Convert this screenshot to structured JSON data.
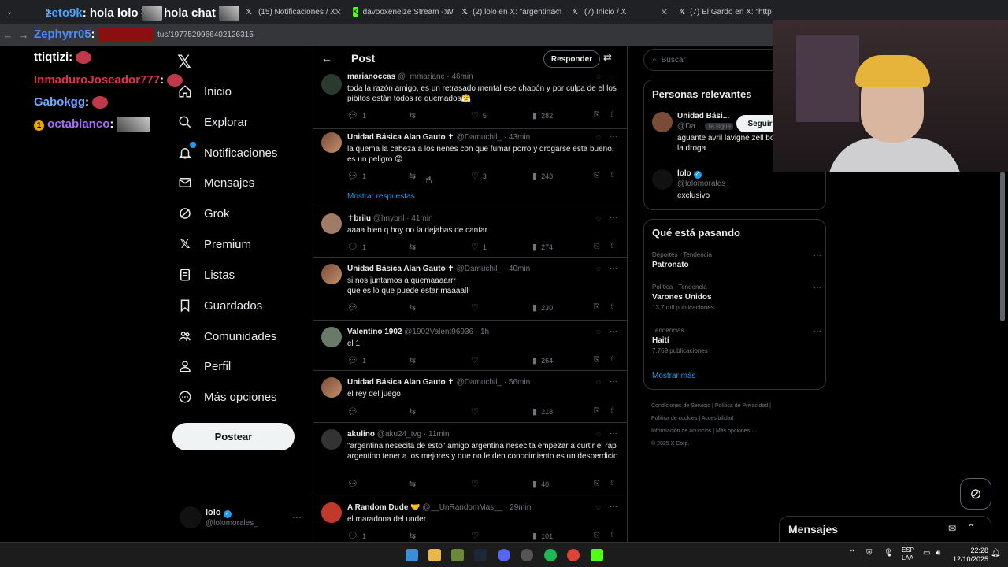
{
  "browser": {
    "tabs": [
      {
        "label": "",
        "icon": "x-logo-icon"
      },
      {
        "label": "",
        "icon": "x-logo-icon"
      },
      {
        "label": "(15) Notificaciones / X",
        "icon": "x-logo-icon"
      },
      {
        "label": "davooxeneize Stream - W",
        "icon": "kick-icon"
      },
      {
        "label": "(2) lolo en X: \"argentina n",
        "icon": "x-logo-icon"
      },
      {
        "label": "(7) Inicio / X",
        "icon": "x-logo-icon"
      },
      {
        "label": "(7) El Gardo en X: \"https",
        "icon": "x-logo-icon"
      }
    ],
    "url": "tus/1977529966402126315"
  },
  "chat": [
    {
      "user": "zeto9k",
      "message": "hola lolo",
      "color": "#4aa3ff"
    },
    {
      "user": "",
      "message": "hola chat",
      "color": "#ffffff"
    },
    {
      "user": "Zephyrr05",
      "message": "",
      "color": "#4a8cff"
    },
    {
      "user": "ttiqtizi",
      "message": "",
      "color": "#ffffff"
    },
    {
      "user": "InmaduroJoseador777",
      "message": "",
      "color": "#e0334a"
    },
    {
      "user": "Gabokgg",
      "message": "",
      "color": "#6fa8ff"
    },
    {
      "user": "octablanco",
      "message": "",
      "color": "#a56bff"
    }
  ],
  "chat_badge": "1",
  "nav": {
    "items": [
      {
        "label": "Inicio",
        "icon": "home-icon"
      },
      {
        "label": "Explorar",
        "icon": "search-icon"
      },
      {
        "label": "Notificaciones",
        "icon": "bell-icon"
      },
      {
        "label": "Mensajes",
        "icon": "mail-icon"
      },
      {
        "label": "Grok",
        "icon": "grok-icon"
      },
      {
        "label": "Premium",
        "icon": "x-logo-icon"
      },
      {
        "label": "Listas",
        "icon": "list-icon"
      },
      {
        "label": "Guardados",
        "icon": "bookmark-icon"
      },
      {
        "label": "Comunidades",
        "icon": "communities-icon"
      },
      {
        "label": "Perfil",
        "icon": "person-icon"
      },
      {
        "label": "Más opciones",
        "icon": "more-circle-icon"
      }
    ],
    "post_label": "Postear",
    "me": {
      "name": "lolo",
      "handle": "@lolomorales_"
    }
  },
  "header": {
    "title": "Post",
    "reply_label": "Responder"
  },
  "tweets": [
    {
      "name": "marianoccas",
      "handle": "@_mmarianc",
      "time": "46min",
      "text": "toda la razón amigo, es un retrasado mental ese chabón y por culpa de el los pibitos están todos re quemados😤",
      "replies": "1",
      "reposts": "",
      "likes": "5",
      "views": "282"
    },
    {
      "name": "Unidad Básica Alan Gauto ✝",
      "handle": "@Damuchil_",
      "time": "43min",
      "text": "la quema la cabeza a los nenes con que fumar porro y drogarse esta bueno, es un peligro 😡",
      "replies": "1",
      "reposts": "",
      "likes": "3",
      "views": "248"
    },
    {
      "name": "✝brilu",
      "handle": "@hnybril",
      "time": "41min",
      "text": "aaaa bien q hoy no la dejabas de cantar",
      "replies": "1",
      "reposts": "",
      "likes": "1",
      "views": "274"
    },
    {
      "name": "Unidad Básica Alan Gauto ✝",
      "handle": "@Damuchil_",
      "time": "40min",
      "text": "si nos juntamos a quemaaaarrr\nque es lo que puede estar maaaalll",
      "replies": "",
      "reposts": "",
      "likes": "",
      "views": "230"
    },
    {
      "name": "Valentino 1902",
      "handle": "@1902Valent96936",
      "time": "1h",
      "text": "el 1.",
      "replies": "1",
      "reposts": "",
      "likes": "",
      "views": "264"
    },
    {
      "name": "Unidad Básica Alan Gauto ✝",
      "handle": "@Damuchil_",
      "time": "56min",
      "text": "el rey del juego",
      "replies": "",
      "reposts": "",
      "likes": "",
      "views": "218"
    },
    {
      "name": "akulino",
      "handle": "@aku24_tvg",
      "time": "11min",
      "text": "\"argentina nesecita de esto\" amigo argentina nesecita empezar a curtir el rap argentino tener a los mejores y que no le den conocimiento es un desperdicio",
      "replies": "",
      "reposts": "",
      "likes": "",
      "views": "40"
    },
    {
      "name": "A Random Dude 🤝",
      "handle": "@__UnRandomMas__",
      "time": "29min",
      "text": "el maradona del under",
      "replies": "1",
      "reposts": "",
      "likes": "",
      "views": "101"
    }
  ],
  "show_replies": "Mostrar respuestas",
  "right": {
    "search_placeholder": "Buscar",
    "relevant_title": "Personas relevantes",
    "relevant": [
      {
        "name": "Unidad Bási...",
        "handle": "@Da...",
        "follows_you": "Te sigue",
        "bio": "aguante avril lavigne zell bo... mi novia y la droga",
        "button": "Seguir"
      },
      {
        "name": "lolo",
        "handle": "@lolomorales_",
        "bio": "exclusivo"
      }
    ],
    "trends_title": "Qué está pasando",
    "trends": [
      {
        "context": "Deportes · Tendencia",
        "title": "Patronato",
        "count": ""
      },
      {
        "context": "Política · Tendencia",
        "title": "Varones Unidos",
        "count": "13,7 mil publicaciones"
      },
      {
        "context": "Tendencias",
        "title": "Haití",
        "count": "7.769 publicaciones"
      }
    ],
    "show_more": "Mostrar más",
    "footer": [
      "Condiciones de Servicio",
      "Política de Privacidad",
      "Política de cookies",
      "Accesibilidad",
      "Información de anuncios",
      "Más opciones ···",
      "© 2025 X Corp."
    ]
  },
  "messages_label": "Mensajes",
  "taskbar": {
    "lang": "ESP",
    "lang2": "LAA",
    "time": "22:28",
    "date": "12/10/2025"
  }
}
